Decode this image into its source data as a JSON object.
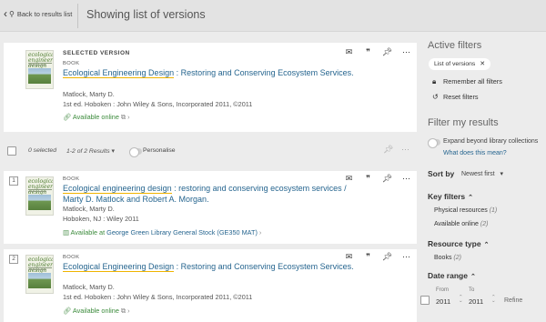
{
  "header": {
    "back_label": "Back to results list",
    "title": "Showing list of versions"
  },
  "selected": {
    "label": "SELECTED VERSION",
    "type": "BOOK",
    "title_hl": "Ecological Engineering Design",
    "title_rest": " : Restoring and Conserving Ecosystem Services.",
    "author": "Matlock, Marty D.",
    "publication": "1st ed. Hoboken : John Wiley & Sons, Incorporated 2011, ©2011",
    "availability": "Available online"
  },
  "results_bar": {
    "selected": "0 selected",
    "range": "1-2 of 2 Results",
    "personalise": "Personalise"
  },
  "results": [
    {
      "num": "1",
      "type": "BOOK",
      "title_hl": "Ecological engineering design",
      "title_rest": " : restoring and conserving ecosystem services / Marty D. Matlock and Robert A. Morgan.",
      "author": "Matlock, Marty D.",
      "publication": "Hoboken, NJ : Wiley 2011",
      "availability": "Available at",
      "location": "George Green Library  General Stock (GE350 MAT)"
    },
    {
      "num": "2",
      "type": "BOOK",
      "title_hl": "Ecological Engineering Design",
      "title_rest": " : Restoring and Conserving Ecosystem Services.",
      "author": "Matlock, Marty D.",
      "publication": "1st ed. Hoboken : John Wiley & Sons, Incorporated 2011, ©2011",
      "availability": "Available online"
    }
  ],
  "thumbnail": {
    "cover_text": "ecological engineering design"
  },
  "sidebar": {
    "active_filters_heading": "Active filters",
    "chip": "List of versions",
    "remember": "Remember all filters",
    "reset": "Reset filters",
    "filter_heading": "Filter my results",
    "expand": "Expand beyond library collections",
    "what_does": "What does this mean?",
    "sort_by": "Sort by",
    "sort_value": "Newest first",
    "key_filters": "Key filters",
    "key_items": [
      {
        "label": "Physical resources",
        "count": "(1)"
      },
      {
        "label": "Available online",
        "count": "(2)"
      }
    ],
    "resource_type": "Resource type",
    "resource_items": [
      {
        "label": "Books",
        "count": "(2)"
      }
    ],
    "date_range": "Date range",
    "from_label": "From",
    "to_label": "To",
    "from_value": "2011",
    "to_value": "2011",
    "refine": "Refine"
  },
  "colors": {
    "link": "#26658f",
    "available": "#3a8a3a",
    "highlight": "#f0b400"
  }
}
